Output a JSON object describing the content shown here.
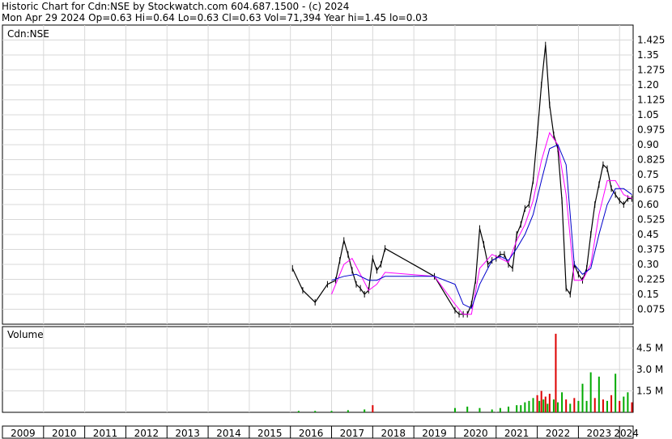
{
  "header": {
    "line1": "Historic Chart for Cdn:NSE by Stockwatch.com 604.687.1500 - (c) 2024",
    "line2": "Mon Apr 29 2024  Op=0.63  Hi=0.64  Lo=0.63  Cl=0.63  Vol=71,394  Year hi=1.45  lo=0.03"
  },
  "chart_data": [
    {
      "type": "line",
      "panel": "price",
      "label": "Cdn:NSE",
      "ylim": [
        0,
        1.5
      ],
      "y_ticks": [
        "1.425",
        "1.35",
        "1.275",
        "1.20",
        "1.125",
        "1.05",
        "0.975",
        "0.90",
        "0.825",
        "0.75",
        "0.675",
        "0.60",
        "0.525",
        "0.45",
        "0.375",
        "0.30",
        "0.225",
        "0.15",
        "0.075"
      ],
      "y_tick_values": [
        1.425,
        1.35,
        1.275,
        1.2,
        1.125,
        1.05,
        0.975,
        0.9,
        0.825,
        0.75,
        0.675,
        0.6,
        0.525,
        0.45,
        0.375,
        0.3,
        0.225,
        0.15,
        0.075
      ],
      "grid": true,
      "x_year_ticks": [
        "2009",
        "2010",
        "2011",
        "2012",
        "2013",
        "2014",
        "2015",
        "2016",
        "2017",
        "2018",
        "2019",
        "2020",
        "2021",
        "2022",
        "2023",
        "2024"
      ],
      "series": [
        {
          "kind": "price",
          "color": "#000000",
          "x": [
            2016.05,
            2016.3,
            2016.6,
            2016.9,
            2017.1,
            2017.2,
            2017.3,
            2017.4,
            2017.5,
            2017.6,
            2017.7,
            2017.8,
            2017.9,
            2018.0,
            2018.1,
            2018.2,
            2018.3,
            2019.5,
            2020.0,
            2020.1,
            2020.2,
            2020.3,
            2020.4,
            2020.5,
            2020.6,
            2020.7,
            2020.8,
            2020.9,
            2021.0,
            2021.1,
            2021.2,
            2021.3,
            2021.4,
            2021.5,
            2021.6,
            2021.7,
            2021.8,
            2021.9,
            2022.0,
            2022.1,
            2022.2,
            2022.3,
            2022.4,
            2022.5,
            2022.6,
            2022.7,
            2022.8,
            2022.9,
            2023.0,
            2023.1,
            2023.2,
            2023.3,
            2023.4,
            2023.5,
            2023.6,
            2023.7,
            2023.8,
            2023.9,
            2024.0,
            2024.1,
            2024.2,
            2024.3
          ],
          "y": [
            0.28,
            0.17,
            0.11,
            0.2,
            0.22,
            0.32,
            0.42,
            0.35,
            0.27,
            0.2,
            0.18,
            0.15,
            0.17,
            0.33,
            0.27,
            0.3,
            0.38,
            0.24,
            0.07,
            0.05,
            0.05,
            0.05,
            0.1,
            0.22,
            0.48,
            0.4,
            0.3,
            0.32,
            0.33,
            0.35,
            0.35,
            0.3,
            0.28,
            0.45,
            0.5,
            0.58,
            0.6,
            0.72,
            0.95,
            1.2,
            1.4,
            1.1,
            0.95,
            0.88,
            0.62,
            0.18,
            0.15,
            0.3,
            0.25,
            0.22,
            0.28,
            0.45,
            0.6,
            0.7,
            0.8,
            0.78,
            0.68,
            0.65,
            0.62,
            0.6,
            0.63,
            0.63
          ]
        },
        {
          "kind": "moving-average-short",
          "color": "#ff00ff",
          "x": [
            2017.0,
            2017.3,
            2017.5,
            2017.7,
            2017.9,
            2018.1,
            2018.3,
            2019.5,
            2020.0,
            2020.2,
            2020.4,
            2020.6,
            2020.9,
            2021.1,
            2021.3,
            2021.5,
            2021.7,
            2021.9,
            2022.1,
            2022.3,
            2022.5,
            2022.7,
            2022.9,
            2023.1,
            2023.3,
            2023.5,
            2023.7,
            2023.9,
            2024.1,
            2024.3
          ],
          "y": [
            0.15,
            0.3,
            0.33,
            0.25,
            0.17,
            0.2,
            0.26,
            0.24,
            0.1,
            0.05,
            0.05,
            0.28,
            0.35,
            0.33,
            0.31,
            0.42,
            0.5,
            0.62,
            0.82,
            0.96,
            0.9,
            0.65,
            0.22,
            0.22,
            0.3,
            0.55,
            0.72,
            0.72,
            0.65,
            0.63
          ]
        },
        {
          "kind": "moving-average-long",
          "color": "#0000cc",
          "x": [
            2017.0,
            2017.3,
            2017.6,
            2017.9,
            2018.1,
            2018.3,
            2019.5,
            2020.0,
            2020.2,
            2020.4,
            2020.6,
            2020.9,
            2021.1,
            2021.3,
            2021.5,
            2021.7,
            2021.9,
            2022.1,
            2022.3,
            2022.5,
            2022.7,
            2022.9,
            2023.1,
            2023.3,
            2023.5,
            2023.7,
            2023.9,
            2024.1,
            2024.3
          ],
          "y": [
            0.22,
            0.24,
            0.25,
            0.22,
            0.22,
            0.24,
            0.24,
            0.2,
            0.1,
            0.08,
            0.2,
            0.32,
            0.34,
            0.32,
            0.38,
            0.45,
            0.55,
            0.72,
            0.88,
            0.9,
            0.8,
            0.3,
            0.25,
            0.28,
            0.45,
            0.6,
            0.68,
            0.68,
            0.65
          ]
        }
      ]
    },
    {
      "type": "bar",
      "panel": "volume",
      "label": "Volume",
      "ylim": [
        0,
        6.0
      ],
      "y_ticks": [
        "4.5 M",
        "3.0 M",
        "1.5 M"
      ],
      "y_tick_values": [
        4.5,
        3.0,
        1.5
      ],
      "unit": "M",
      "colors": {
        "up": "#00aa00",
        "down": "#dd0000"
      },
      "x": [
        2016.2,
        2016.6,
        2017.0,
        2017.4,
        2017.8,
        2018.0,
        2020.0,
        2020.3,
        2020.6,
        2020.9,
        2021.1,
        2021.3,
        2021.5,
        2021.6,
        2021.7,
        2021.8,
        2021.9,
        2022.0,
        2022.05,
        2022.1,
        2022.15,
        2022.2,
        2022.25,
        2022.3,
        2022.4,
        2022.45,
        2022.5,
        2022.6,
        2022.7,
        2022.8,
        2022.9,
        2023.0,
        2023.1,
        2023.2,
        2023.3,
        2023.4,
        2023.5,
        2023.6,
        2023.7,
        2023.8,
        2023.9,
        2024.0,
        2024.1,
        2024.2,
        2024.3
      ],
      "values": [
        0.1,
        0.1,
        0.1,
        0.15,
        0.2,
        0.5,
        0.3,
        0.4,
        0.3,
        0.2,
        0.3,
        0.4,
        0.5,
        0.5,
        0.7,
        0.8,
        1.0,
        1.2,
        0.8,
        1.5,
        0.9,
        1.1,
        0.6,
        1.3,
        0.9,
        5.5,
        0.7,
        1.4,
        0.9,
        0.6,
        1.0,
        0.8,
        2.0,
        0.8,
        2.8,
        1.0,
        2.5,
        0.9,
        0.8,
        1.2,
        2.7,
        0.8,
        1.1,
        1.4,
        0.7
      ],
      "up": [
        true,
        true,
        true,
        true,
        true,
        false,
        true,
        true,
        true,
        true,
        true,
        true,
        true,
        true,
        true,
        true,
        true,
        false,
        true,
        false,
        true,
        false,
        true,
        false,
        true,
        false,
        true,
        true,
        false,
        true,
        false,
        true,
        true,
        true,
        true,
        false,
        true,
        false,
        true,
        false,
        true,
        false,
        true,
        true,
        false
      ]
    }
  ]
}
